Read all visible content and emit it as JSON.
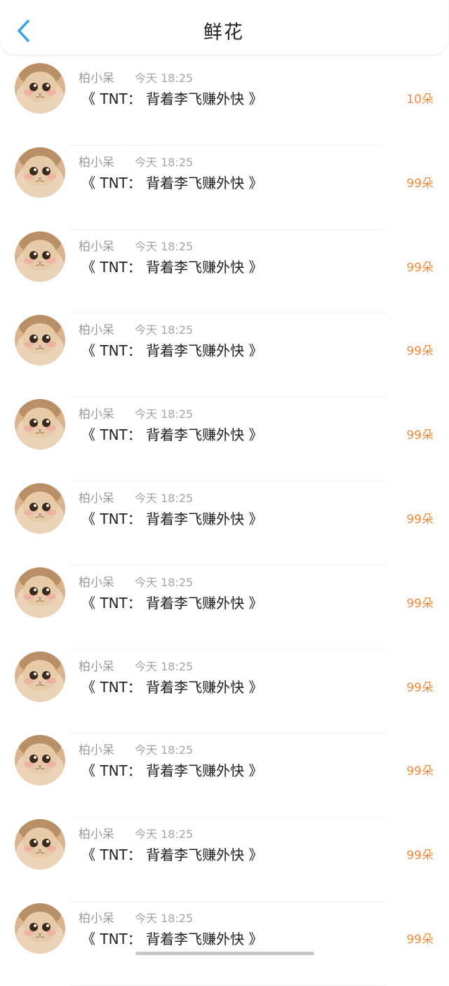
{
  "header": {
    "title": "鲜花",
    "back_icon": "chevron-left-icon",
    "accent_color": "#3aa0e8"
  },
  "colors": {
    "count": "#f08a3e",
    "meta": "#9a9a9a",
    "text": "#222222"
  },
  "items": [
    {
      "name": "柏小呆",
      "time": "今天 18:25",
      "work": "《 TNT： 背着李飞赚外快 》",
      "count": "10朵"
    },
    {
      "name": "柏小呆",
      "time": "今天 18:25",
      "work": "《 TNT： 背着李飞赚外快 》",
      "count": "99朵"
    },
    {
      "name": "柏小呆",
      "time": "今天 18:25",
      "work": "《 TNT： 背着李飞赚外快 》",
      "count": "99朵"
    },
    {
      "name": "柏小呆",
      "time": "今天 18:25",
      "work": "《 TNT： 背着李飞赚外快 》",
      "count": "99朵"
    },
    {
      "name": "柏小呆",
      "time": "今天 18:25",
      "work": "《 TNT： 背着李飞赚外快 》",
      "count": "99朵"
    },
    {
      "name": "柏小呆",
      "time": "今天 18:25",
      "work": "《 TNT： 背着李飞赚外快 》",
      "count": "99朵"
    },
    {
      "name": "柏小呆",
      "time": "今天 18:25",
      "work": "《 TNT： 背着李飞赚外快 》",
      "count": "99朵"
    },
    {
      "name": "柏小呆",
      "time": "今天 18:25",
      "work": "《 TNT： 背着李飞赚外快 》",
      "count": "99朵"
    },
    {
      "name": "柏小呆",
      "time": "今天 18:25",
      "work": "《 TNT： 背着李飞赚外快 》",
      "count": "99朵"
    },
    {
      "name": "柏小呆",
      "time": "今天 18:25",
      "work": "《 TNT： 背着李飞赚外快 》",
      "count": "99朵"
    },
    {
      "name": "柏小呆",
      "time": "今天 18:25",
      "work": "《 TNT： 背着李飞赚外快 》",
      "count": "99朵"
    }
  ]
}
